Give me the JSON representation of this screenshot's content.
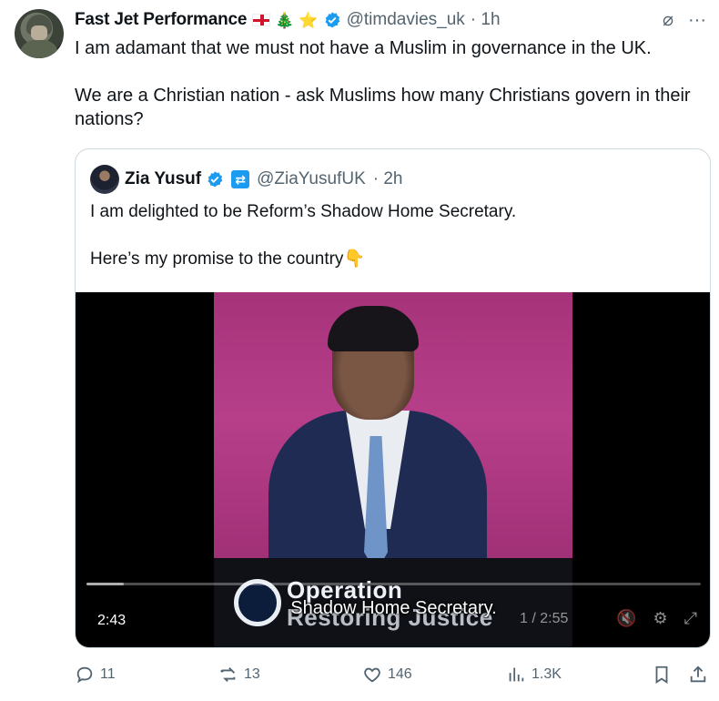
{
  "tweet": {
    "author_name": "Fast Jet Performance",
    "emoji_tree": "🎄",
    "emoji_star": "⭐",
    "handle": "@timdavies_uk",
    "time": "· 1h",
    "text": "I am adamant that we must not have a Muslim in governance in the UK.\n\nWe are a Christian nation - ask Muslims how many Christians govern in their nations?"
  },
  "top_icons": {
    "grok": "⌀",
    "more": "···"
  },
  "quote": {
    "author_name": "Zia Yusuf",
    "badge": "⇄",
    "handle": "@ZiaYusufUK",
    "time": "· 2h",
    "text": "I am delighted to be Reform’s Shadow Home Secretary.\n\nHere’s my promise to the country",
    "emoji_point": "👇"
  },
  "video": {
    "logo_line1": "Operation",
    "logo_line2": "Restoring Justice",
    "caption": "Shadow Home Secretary.",
    "elapsed": "2:43",
    "duration": "1 / 2:55",
    "progress": 0.06
  },
  "actions": {
    "replies": "11",
    "reposts": "13",
    "likes": "146",
    "views": "1.3K"
  },
  "colors": {
    "accent": "#1d9bf0",
    "muted": "#536471",
    "border": "#cfd9de"
  }
}
